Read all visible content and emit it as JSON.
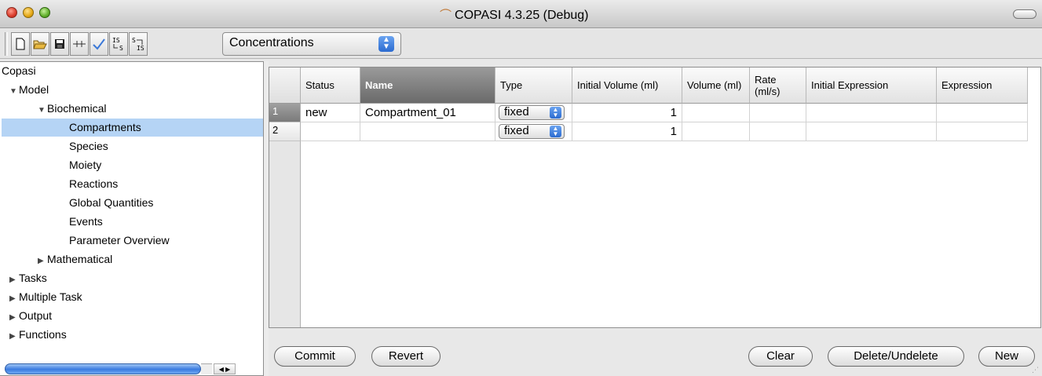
{
  "window": {
    "title": "COPASI 4.3.25 (Debug)"
  },
  "toolbar": {
    "buttons": [
      {
        "name": "new-file-icon",
        "glyph": "🗋"
      },
      {
        "name": "open-folder-icon",
        "glyph": "📂"
      },
      {
        "name": "save-icon",
        "glyph": "💾"
      },
      {
        "name": "slider-icon",
        "glyph": "⊣⊢"
      },
      {
        "name": "check-icon",
        "glyph": "✓"
      },
      {
        "name": "initial-to-state-icon",
        "glyph": "IS→S"
      },
      {
        "name": "state-to-initial-icon",
        "glyph": "S→IS"
      }
    ],
    "unit_select": "Concentrations"
  },
  "tree": {
    "root": "Copasi",
    "model": "Model",
    "biochemical": "Biochemical",
    "compartments": "Compartments",
    "species": "Species",
    "moiety": "Moiety",
    "reactions": "Reactions",
    "global_quantities": "Global Quantities",
    "events": "Events",
    "parameter_overview": "Parameter Overview",
    "mathematical": "Mathematical",
    "tasks": "Tasks",
    "multiple_task": "Multiple Task",
    "output": "Output",
    "functions": "Functions",
    "expanded_glyph": "▼",
    "collapsed_glyph": "▶"
  },
  "table": {
    "headers": {
      "status": "Status",
      "name": "Name",
      "type": "Type",
      "initial_volume": "Initial Volume (ml)",
      "volume": "Volume (ml)",
      "rate": "Rate (ml/s)",
      "initial_expression": "Initial Expression",
      "expression": "Expression"
    },
    "rows": [
      {
        "index": "1",
        "status": "new",
        "name": "Compartment_01",
        "type": "fixed",
        "initial_volume": "1",
        "volume": "",
        "rate": "",
        "initial_expression": "",
        "expression": ""
      },
      {
        "index": "2",
        "status": "",
        "name": "",
        "type": "fixed",
        "initial_volume": "1",
        "volume": "",
        "rate": "",
        "initial_expression": "",
        "expression": ""
      }
    ]
  },
  "buttons": {
    "commit": "Commit",
    "revert": "Revert",
    "clear": "Clear",
    "delete_undelete": "Delete/Undelete",
    "new": "New"
  }
}
